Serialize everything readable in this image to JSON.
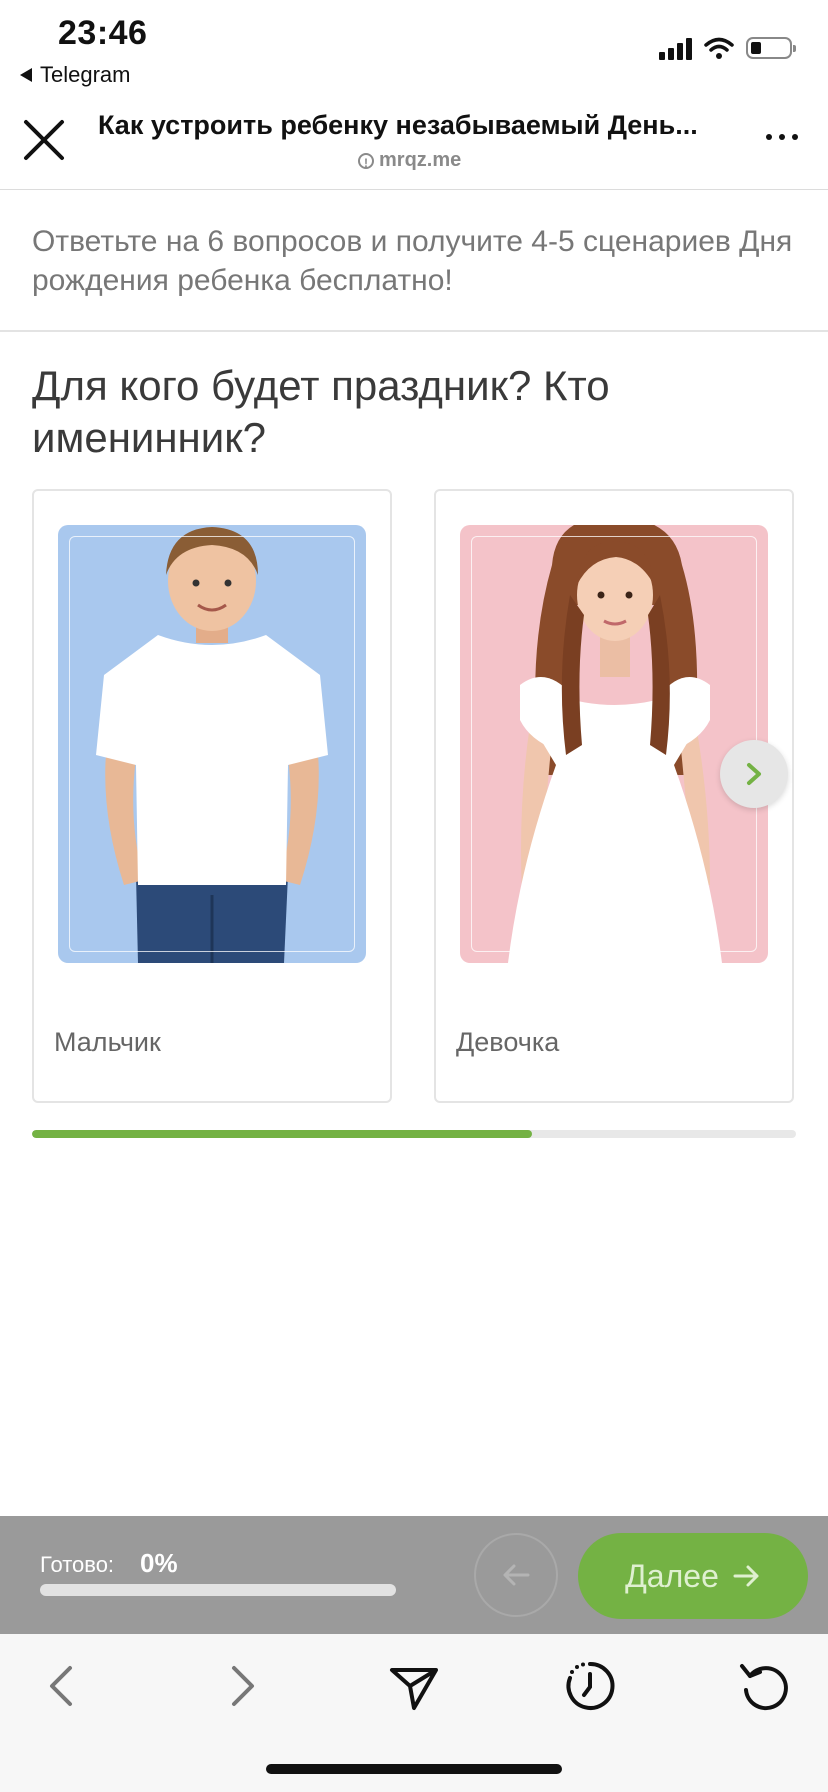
{
  "status_bar": {
    "time": "23:46",
    "back_app": "Telegram"
  },
  "browser": {
    "title": "Как устроить ребенку незабываемый День...",
    "domain": "mrqz.me"
  },
  "quiz": {
    "intro": "Ответьте на 6 вопросов и получите 4-5 сценариев Дня рождения ребенка бесплатно!",
    "question": "Для кого будет праздник? Кто именинник?",
    "options": [
      {
        "label": "Мальчик",
        "bg_color": "#a9c8ee"
      },
      {
        "label": "Девочка",
        "bg_color": "#f4c3c9"
      }
    ],
    "question_progress_fraction": 0.655
  },
  "bottom_bar": {
    "ready_label": "Готово:",
    "ready_value": "0%",
    "next_label": "Далее"
  },
  "colors": {
    "accent_green": "#74b244",
    "bottom_bar_gray": "#9a9a9a"
  },
  "icons": {
    "close": "close-icon",
    "more": "more-dots-icon",
    "back": "chevron-left-icon",
    "forward": "chevron-right-icon",
    "share": "send-icon",
    "history": "history-icon",
    "reload": "reload-icon"
  }
}
